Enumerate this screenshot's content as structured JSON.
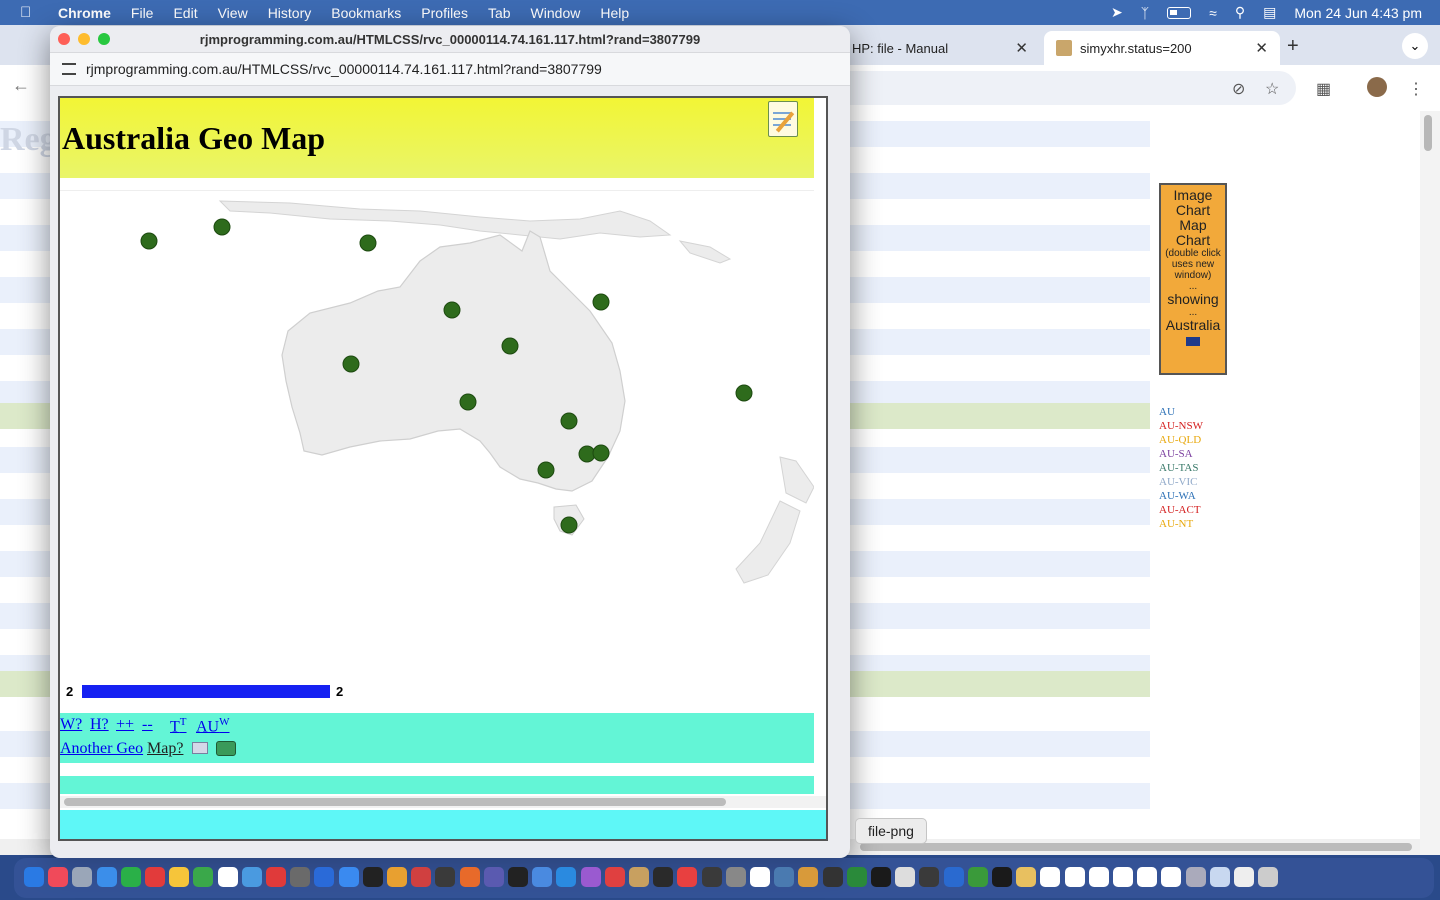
{
  "menubar": {
    "app_name": "Chrome",
    "items": [
      "File",
      "Edit",
      "View",
      "History",
      "Bookmarks",
      "Profiles",
      "Tab",
      "Window",
      "Help"
    ],
    "clock": "Mon 24 Jun  4:43 pm"
  },
  "background_window": {
    "tabs": [
      {
        "label": "HP: file - Manual",
        "active": false
      },
      {
        "label": "simyxhr.status=200",
        "active": true
      }
    ],
    "page_fragment_text": "Reg",
    "info_box": {
      "line1": "Image",
      "line2": "Chart",
      "line3": "Map",
      "line4": "Chart",
      "note": "(double click uses new window)",
      "ellipsis1": "...",
      "showing": "showing",
      "ellipsis2": "...",
      "country": "Australia",
      "flag_icon": "australia-flag-icon"
    },
    "regions": [
      {
        "code": "AU",
        "color": "#2a6fb5"
      },
      {
        "code": "AU-NSW",
        "color": "#d42020"
      },
      {
        "code": "AU-QLD",
        "color": "#e8a80c"
      },
      {
        "code": "AU-SA",
        "color": "#7a3e9e"
      },
      {
        "code": "AU-TAS",
        "color": "#3a7a6a"
      },
      {
        "code": "AU-VIC",
        "color": "#8fa8c8"
      },
      {
        "code": "AU-WA",
        "color": "#2a6fb5"
      },
      {
        "code": "AU-ACT",
        "color": "#d42020"
      },
      {
        "code": "AU-NT",
        "color": "#e8a80c"
      }
    ]
  },
  "popup": {
    "title": "rjmprogramming.com.au/HTMLCSS/rvc_00000114.74.161.117.html?rand=3807799",
    "url": "rjmprogramming.com.au/HTMLCSS/rvc_00000114.74.161.117.html?rand=3807799",
    "heading": "Australia Geo Map",
    "legend": {
      "min": "2",
      "max": "2",
      "color": "#1521f2"
    },
    "controls": {
      "w_link": "W?",
      "h_link": "H?",
      "plus_link": "++",
      "minus_link": "--",
      "tt_link": "T",
      "tt_sup": "T",
      "auw_link": "AU",
      "auw_sup": "W",
      "another_geo_link": "Another Geo",
      "map_link": "Map?"
    },
    "marker_color": "#2e6b1c"
  },
  "tooltip": "file-png"
}
